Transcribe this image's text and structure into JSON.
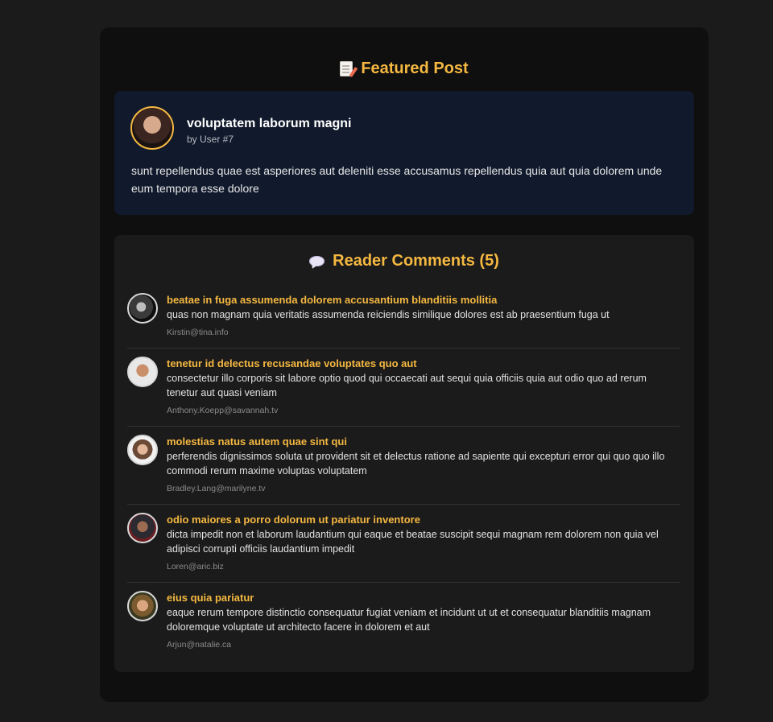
{
  "featured": {
    "heading": "Featured Post",
    "heading_icon": "memo-icon",
    "post": {
      "title": "voluptatem laborum magni",
      "author": "by User #7",
      "body": "sunt repellendus quae est asperiores aut deleniti esse accusamus repellendus quia aut quia dolorem unde eum tempora esse dolore"
    }
  },
  "comments": {
    "heading": "Reader Comments (5)",
    "heading_icon": "speech-bubble-icon",
    "items": [
      {
        "title": "beatae in fuga assumenda dolorem accusantium blanditiis mollitia",
        "body": "quas non magnam quia veritatis assumenda reiciendis similique dolores est ab praesentium fuga ut",
        "email": "Kirstin@tina.info"
      },
      {
        "title": "tenetur id delectus recusandae voluptates quo aut",
        "body": "consectetur illo corporis sit labore optio quod qui occaecati aut sequi quia officiis quia aut odio quo ad rerum tenetur aut quasi veniam",
        "email": "Anthony.Koepp@savannah.tv"
      },
      {
        "title": "molestias natus autem quae sint qui",
        "body": "perferendis dignissimos soluta ut provident sit et delectus ratione ad sapiente qui excepturi error qui quo quo illo commodi rerum maxime voluptas voluptatem",
        "email": "Bradley.Lang@marilyne.tv"
      },
      {
        "title": "odio maiores a porro dolorum ut pariatur inventore",
        "body": "dicta impedit non et laborum laudantium qui eaque et beatae suscipit sequi magnam rem dolorem non quia vel adipisci corrupti officiis laudantium impedit",
        "email": "Loren@aric.biz"
      },
      {
        "title": "eius quia pariatur",
        "body": "eaque rerum tempore distinctio consequatur fugiat veniam et incidunt ut ut et consequatur blanditiis magnam doloremque voluptate ut architecto facere in dolorem et aut",
        "email": "Arjun@natalie.ca"
      }
    ]
  },
  "colors": {
    "accent": "#f5b841",
    "page_bg": "#1b1b1b",
    "panel_bg": "#0f0f0f",
    "post_card_bg": "#111a2c",
    "comments_card_bg": "#1b1b1b"
  }
}
